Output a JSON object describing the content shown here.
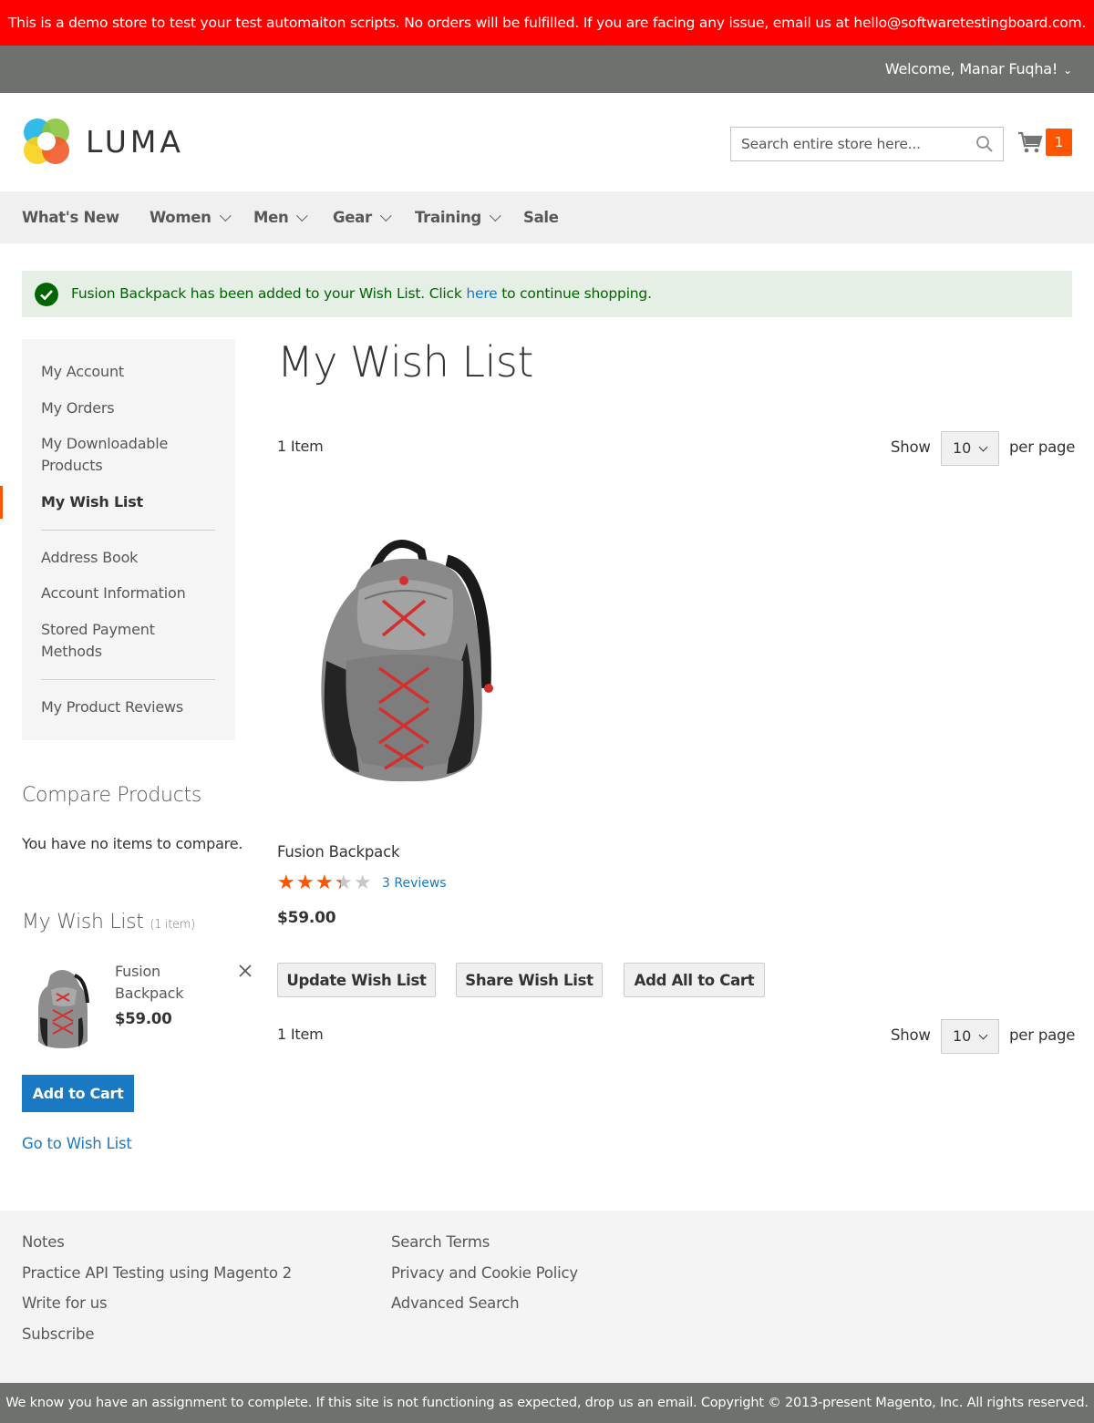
{
  "demo_notice": "This is a demo store to test your test automaiton scripts. No orders will be fulfilled. If you are facing any issue, email us at hello@softwaretestingboard.com.",
  "header": {
    "welcome": "Welcome, Manar Fuqha!",
    "logo_text": "LUMA",
    "search_placeholder": "Search entire store here...",
    "cart_count": "1"
  },
  "nav": {
    "items": [
      {
        "label": "What's New",
        "dropdown": false
      },
      {
        "label": "Women",
        "dropdown": true
      },
      {
        "label": "Men",
        "dropdown": true
      },
      {
        "label": "Gear",
        "dropdown": true
      },
      {
        "label": "Training",
        "dropdown": true
      },
      {
        "label": "Sale",
        "dropdown": false
      }
    ]
  },
  "message": {
    "text_before": "Fusion Backpack has been added to your Wish List. Click ",
    "link": "here",
    "text_after": " to continue shopping."
  },
  "account_nav": {
    "items": [
      {
        "label": "My Account"
      },
      {
        "label": "My Orders"
      },
      {
        "label": "My Downloadable Products"
      },
      {
        "label": "My Wish List",
        "current": true
      },
      {
        "label": "Address Book"
      },
      {
        "label": "Account Information"
      },
      {
        "label": "Stored Payment Methods"
      },
      {
        "label": "My Product Reviews"
      }
    ]
  },
  "compare": {
    "title": "Compare Products",
    "empty": "You have no items to compare."
  },
  "sidebar_wishlist": {
    "title": "My Wish List",
    "count": "(1 item)",
    "product_name": "Fusion Backpack",
    "product_price": "$59.00",
    "add_to_cart": "Add to Cart",
    "go_to_wishlist": "Go to Wish List"
  },
  "main": {
    "title": "My Wish List",
    "amount": "1 Item",
    "show_label": "Show",
    "per_page_value": "10",
    "per_page_label": "per page",
    "product": {
      "name": "Fusion Backpack",
      "rating_percent": 67,
      "reviews": "3 Reviews",
      "price": "$59.00"
    },
    "buttons": {
      "update": "Update Wish List",
      "share": "Share Wish List",
      "add_all": "Add All to Cart"
    }
  },
  "footer": {
    "col1": [
      "Notes",
      "Practice API Testing using Magento 2",
      "Write for us",
      "Subscribe"
    ],
    "col2": [
      "Search Terms",
      "Privacy and Cookie Policy",
      "Advanced Search"
    ],
    "copyright": "We know you have an assignment to complete. If this site is not functioning as expected, drop us an email. Copyright © 2013-present Magento, Inc. All rights reserved."
  },
  "colors": {
    "demo_bar": "#ff0000",
    "accent": "#ff5501",
    "link": "#1979c3",
    "success_bg": "#e5efe5",
    "success_text": "#006400"
  }
}
